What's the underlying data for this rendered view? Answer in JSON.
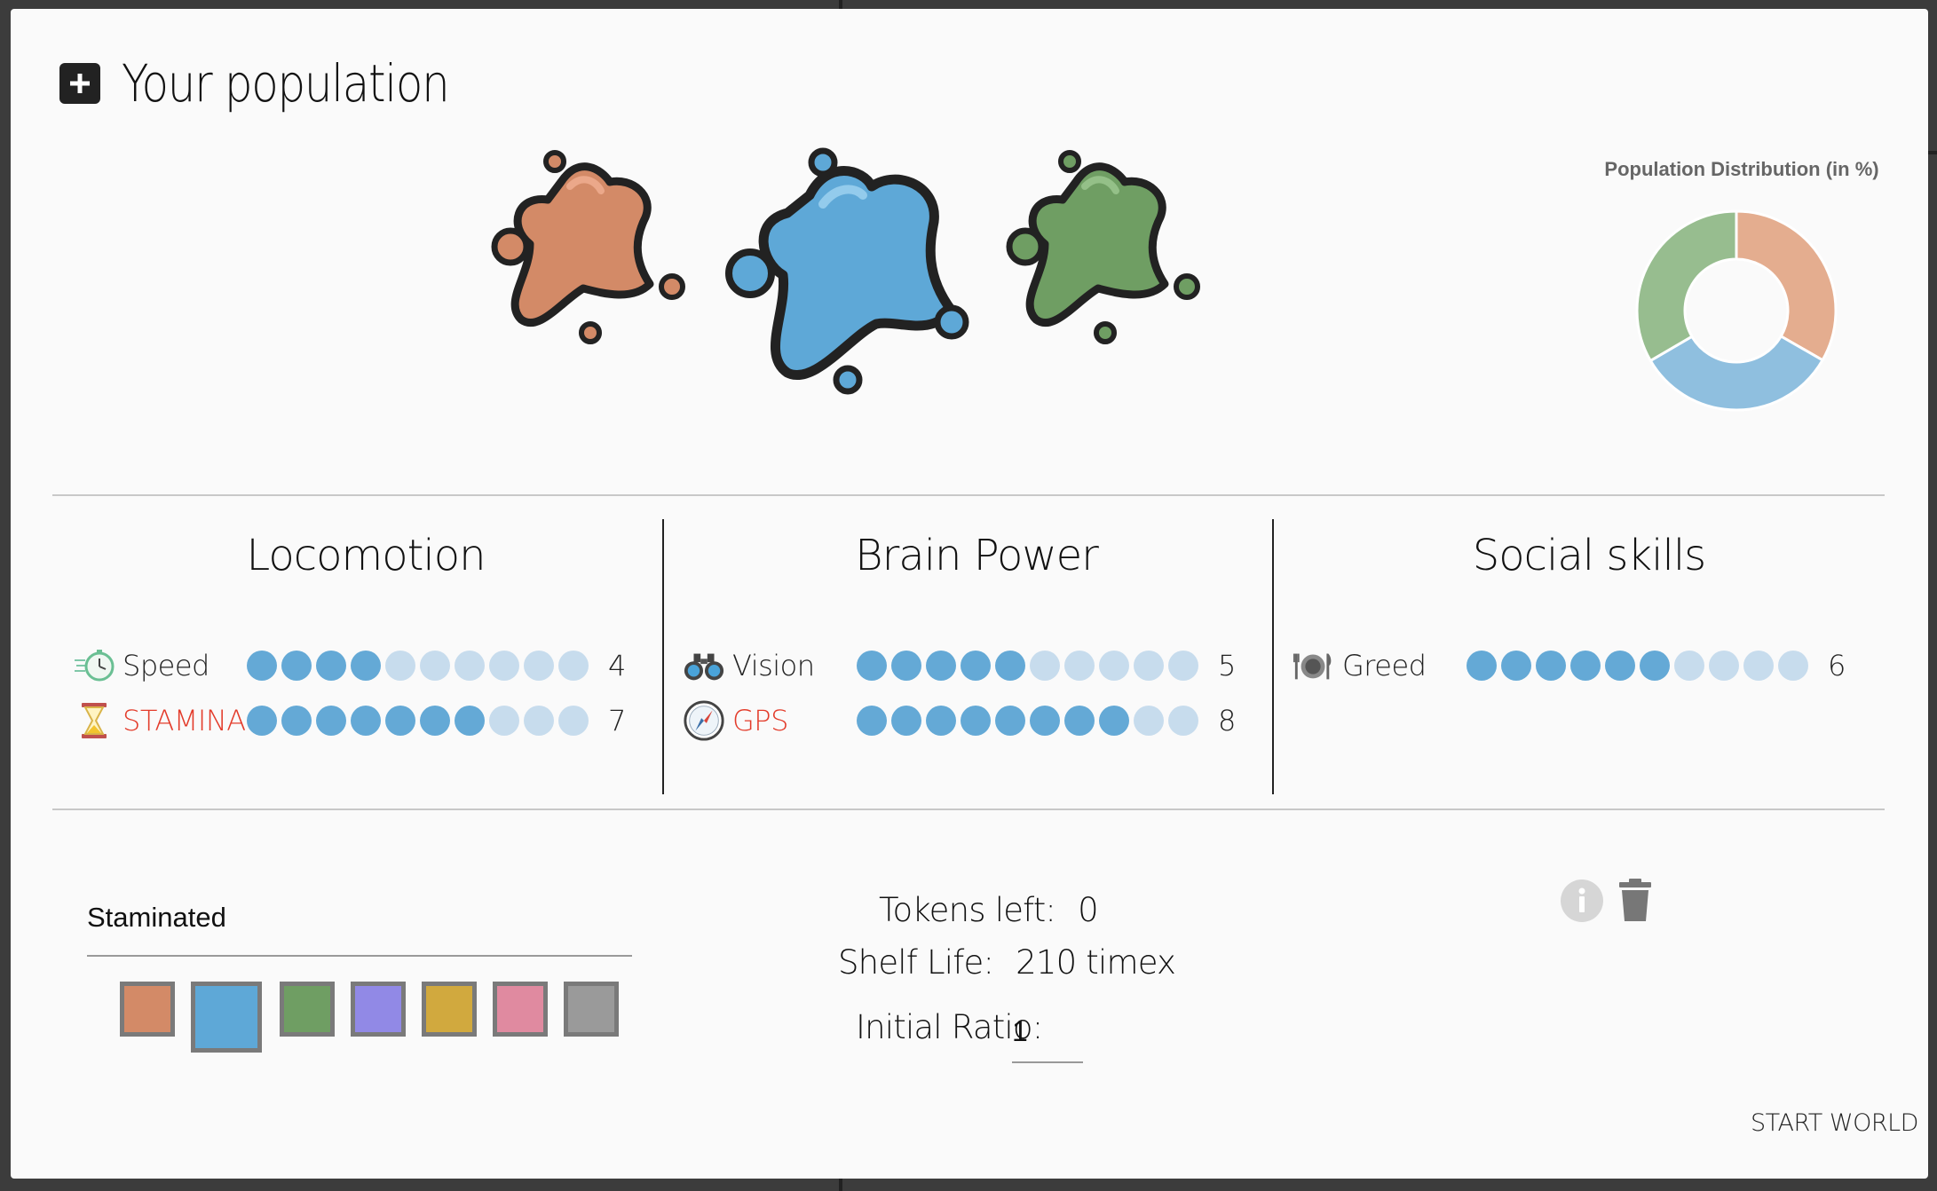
{
  "dialog": {
    "title": "Your population",
    "start_button": "START WORLD"
  },
  "chart_data": {
    "type": "pie",
    "title": "Population Distribution (in %)",
    "categories": [
      "Orange",
      "Blue",
      "Green"
    ],
    "values": [
      33.3,
      33.3,
      33.4
    ],
    "colors": [
      "#e4ad8f",
      "#8fbfdf",
      "#97bd8f"
    ],
    "donut": true
  },
  "sections": [
    {
      "title": "Locomotion",
      "stats": [
        {
          "label": "Speed",
          "value": "4",
          "level": 4,
          "max": 10,
          "highlight": false,
          "icon": "stopwatch-icon"
        },
        {
          "label": "STAMINA",
          "value": "7",
          "level": 7,
          "max": 10,
          "highlight": true,
          "icon": "hourglass-icon"
        }
      ]
    },
    {
      "title": "Brain Power",
      "stats": [
        {
          "label": "Vision",
          "value": "5",
          "level": 5,
          "max": 10,
          "highlight": false,
          "icon": "binoculars-icon"
        },
        {
          "label": "GPS",
          "value": "8",
          "level": 8,
          "max": 10,
          "highlight": true,
          "icon": "compass-icon"
        }
      ]
    },
    {
      "title": "Social skills",
      "stats": [
        {
          "label": "Greed",
          "value": "6",
          "level": 6,
          "max": 10,
          "highlight": false,
          "icon": "plate-cutlery-icon"
        }
      ]
    }
  ],
  "bottom": {
    "staminated_label": "Staminated",
    "swatches": [
      "#d38a67",
      "#5ea8d7",
      "#6f9e63",
      "#9189e6",
      "#d1a93e",
      "#e08aa0",
      "#9a9a9a"
    ],
    "selected_swatch": 1,
    "tokens_label": "Tokens left:",
    "tokens_value": "0",
    "shelf_label": "Shelf Life:",
    "shelf_value": "210 timex",
    "ratio_label": "Initial Ratio:",
    "ratio_value": "1"
  },
  "accent": "#64a9d6",
  "highlight_color": "#e33b2a"
}
